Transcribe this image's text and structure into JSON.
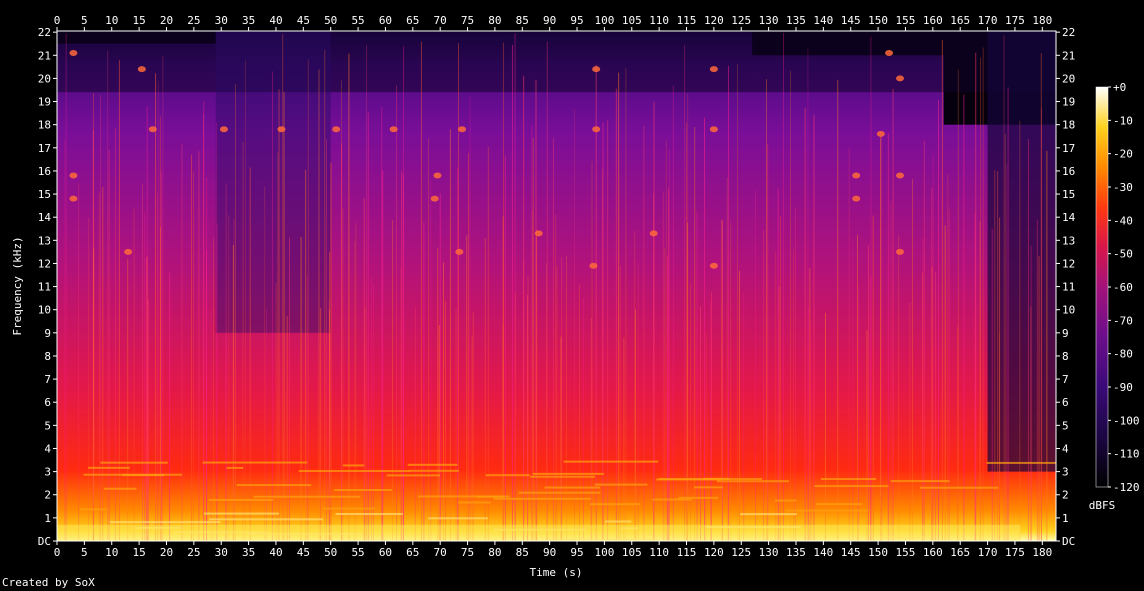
{
  "footer": {
    "credit": "Created by SoX"
  },
  "chart_data": {
    "type": "heatmap",
    "title": "",
    "xlabel": "Time (s)",
    "ylabel": "Frequency (kHz)",
    "xlim": [
      0,
      182.5
    ],
    "ylim": [
      0,
      22.05
    ],
    "x_ticks": [
      0,
      5,
      10,
      15,
      20,
      25,
      30,
      35,
      40,
      45,
      50,
      55,
      60,
      65,
      70,
      75,
      80,
      85,
      90,
      95,
      100,
      105,
      110,
      115,
      120,
      125,
      130,
      135,
      140,
      145,
      150,
      155,
      160,
      165,
      170,
      175,
      180
    ],
    "x_tick_labels": [
      "0",
      "5",
      "10",
      "15",
      "20",
      "25",
      "30",
      "35",
      "40",
      "45",
      "50",
      "55",
      "60",
      "65",
      "70",
      "75",
      "80",
      "85",
      "90",
      "95",
      "100",
      "105",
      "110",
      "115",
      "120",
      "125",
      "130",
      "135",
      "140",
      "145",
      "150",
      "155",
      "160",
      "165",
      "170",
      "175",
      "180"
    ],
    "y_ticks": [
      0,
      1,
      2,
      3,
      4,
      5,
      6,
      7,
      8,
      9,
      10,
      11,
      12,
      13,
      14,
      15,
      16,
      17,
      18,
      19,
      20,
      21,
      22
    ],
    "y_tick_labels": [
      "DC",
      "1",
      "2",
      "3",
      "4",
      "5",
      "6",
      "7",
      "8",
      "9",
      "10",
      "11",
      "12",
      "13",
      "14",
      "15",
      "16",
      "17",
      "18",
      "19",
      "20",
      "21",
      "22"
    ],
    "colorbar": {
      "label": "dBFS",
      "range": [
        -120,
        0
      ],
      "ticks": [
        0,
        -10,
        -20,
        -30,
        -40,
        -50,
        -60,
        -70,
        -80,
        -90,
        -100,
        -110,
        -120
      ],
      "tick_labels": [
        "+0",
        "-10",
        "-20",
        "-30",
        "-40",
        "-50",
        "-60",
        "-70",
        "-80",
        "-90",
        "-100",
        "-110",
        "-120"
      ],
      "colors": [
        "#000000",
        "#1a0640",
        "#3a0a78",
        "#6e0e8c",
        "#a3127a",
        "#d8164a",
        "#ff3a10",
        "#ff8a00",
        "#ffd21e",
        "#ffffff"
      ]
    },
    "approximate_spectral_profile": {
      "description_segments": [
        {
          "t": [
            0,
            29
          ],
          "energy": "high",
          "top_khz": 21.5
        },
        {
          "t": [
            29,
            50
          ],
          "energy": "medium",
          "top_khz": 22
        },
        {
          "t": [
            50,
            66
          ],
          "energy": "high-striped",
          "top_khz": 22
        },
        {
          "t": [
            66,
            87
          ],
          "energy": "high",
          "top_khz": 22
        },
        {
          "t": [
            87,
            127
          ],
          "energy": "high",
          "top_khz": 22
        },
        {
          "t": [
            127,
            162
          ],
          "energy": "high",
          "top_khz": 21
        },
        {
          "t": [
            162,
            182.5
          ],
          "energy": "decaying",
          "top_khz": 18
        }
      ],
      "level_by_freq_khz": [
        [
          0,
          -5
        ],
        [
          1,
          -28
        ],
        [
          2,
          -40
        ],
        [
          4,
          -52
        ],
        [
          8,
          -62
        ],
        [
          14,
          -70
        ],
        [
          18,
          -80
        ],
        [
          22,
          -95
        ]
      ]
    }
  }
}
